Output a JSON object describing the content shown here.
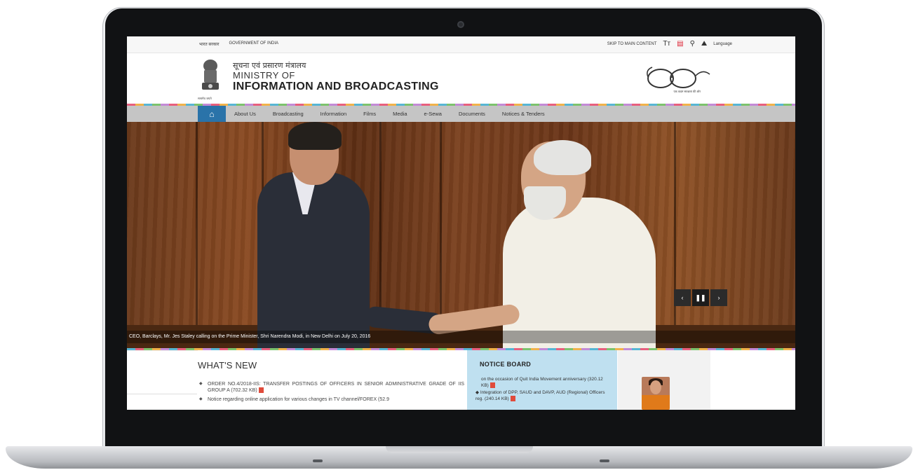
{
  "util_bar": {
    "hindi_gov": "भारत सरकार",
    "gov": "GOVERNMENT OF INDIA",
    "skip": "SKIP TO MAIN CONTENT",
    "text_size_icon": "Tт",
    "language": "Language"
  },
  "header": {
    "title_hindi": "सूचना एवं प्रसारण मंत्रालय",
    "title_line1": "MINISTRY OF",
    "title_line2": "INFORMATION AND BROADCASTING",
    "emblem_motto": "सत्यमेव जयते",
    "swachh_caption": "एक कदम स्वच्छता की ओर"
  },
  "nav": {
    "items": [
      "About Us",
      "Broadcasting",
      "Information",
      "Films",
      "Media",
      "e-Sewa",
      "Documents",
      "Notices & Tenders"
    ]
  },
  "slider": {
    "caption": "CEO, Barclays, Mr. Jes Staley calling on the Prime Minister, Shri Narendra Modi, in New Delhi on July 20, 2016",
    "prev": "‹",
    "pause": "❚❚",
    "next": "›"
  },
  "whats_new": {
    "title": "WHAT'S NEW",
    "items": [
      "ORDER NO.4/2018-IIS: TRANSFER POSTINGS OF OFFICERS IN SENIOR ADMINISTRATIVE GRADE OF IIS GROUP A (702.32 KB)",
      "Notice regarding online application for various changes in TV channel/FOREX (52.9"
    ]
  },
  "notice_board": {
    "title": "NOTICE BOARD",
    "line1": "on the occasion of Quit India Movement anniversary (320.12 KB)",
    "line2": "Integration of DPP, SAUD and DAVP, AUD (Regional) Officers reg. (240.14 KB)"
  },
  "colors": {
    "nav_bg": "#c5c5c5",
    "nav_home": "#2a73a9",
    "notice_bg": "#bfe0f0"
  }
}
